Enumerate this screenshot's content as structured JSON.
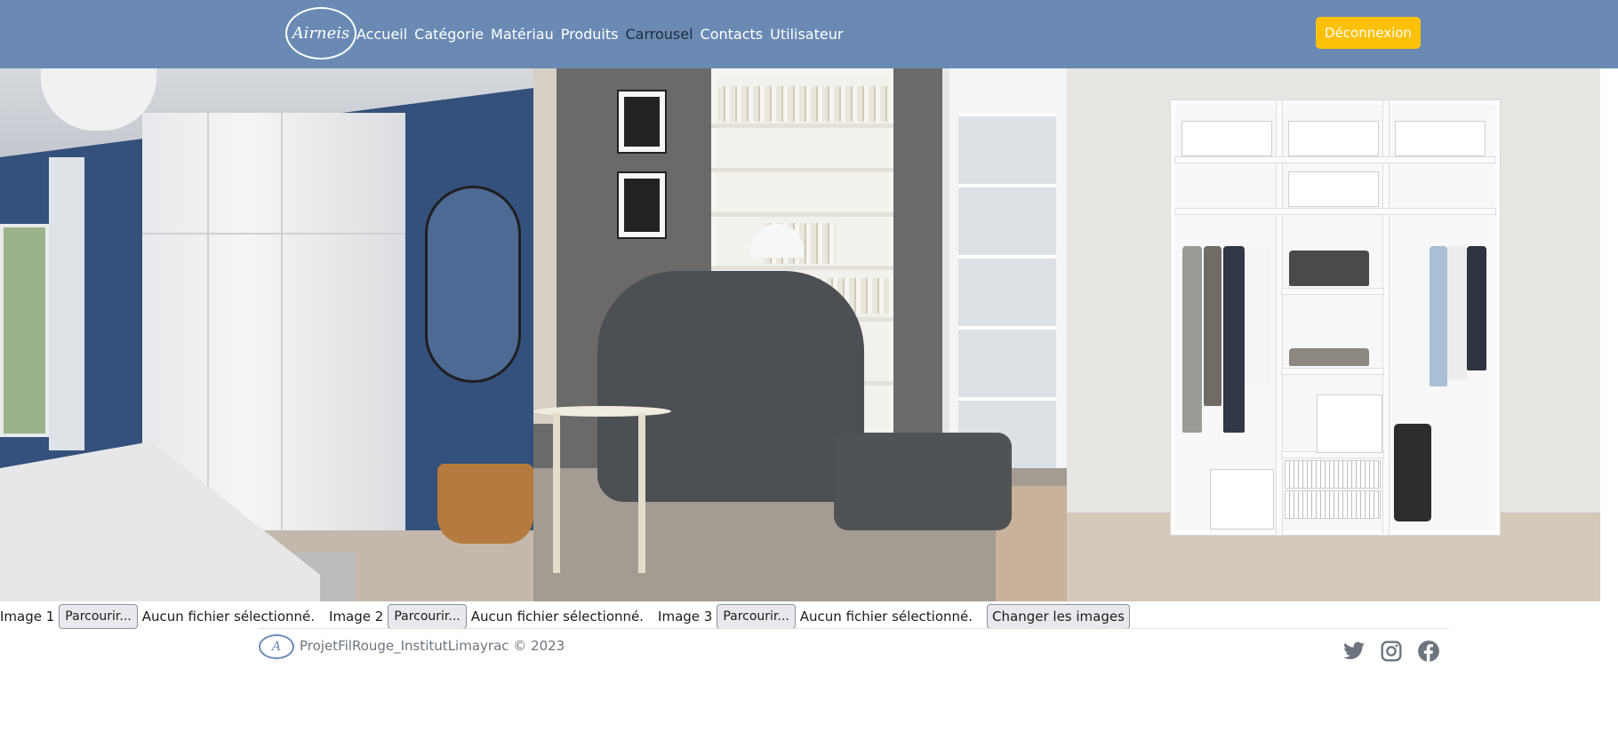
{
  "navbar": {
    "logo_text": "Airneis",
    "links": [
      {
        "label": "Accueil"
      },
      {
        "label": "Catégorie"
      },
      {
        "label": "Matériau"
      },
      {
        "label": "Produits"
      },
      {
        "label": "Carrousel"
      },
      {
        "label": "Contacts"
      },
      {
        "label": "Utilisateur"
      }
    ],
    "active_link": "Carrousel",
    "logout_label": "Déconnexion",
    "colors": {
      "background": "#6a8ab4",
      "logout_button": "#ffc107",
      "active_link": "#1f2a3c"
    }
  },
  "carousel": {
    "slides": [
      {
        "name": "bedroom-wardrobe-image"
      },
      {
        "name": "armchair-living-room-image"
      },
      {
        "name": "open-wardrobe-image"
      }
    ]
  },
  "upload_form": {
    "fields": [
      {
        "label": "Image 1",
        "button_label": "Parcourir...",
        "status": "Aucun fichier sélectionné."
      },
      {
        "label": "Image 2",
        "button_label": "Parcourir...",
        "status": "Aucun fichier sélectionné."
      },
      {
        "label": "Image 3",
        "button_label": "Parcourir...",
        "status": "Aucun fichier sélectionné."
      }
    ],
    "submit_label": "Changer les images"
  },
  "footer": {
    "logo_text": "A",
    "copyright": "ProjetFilRouge_InstitutLimayrac © 2023",
    "social_icons": [
      "twitter-icon",
      "instagram-icon",
      "facebook-icon"
    ]
  }
}
